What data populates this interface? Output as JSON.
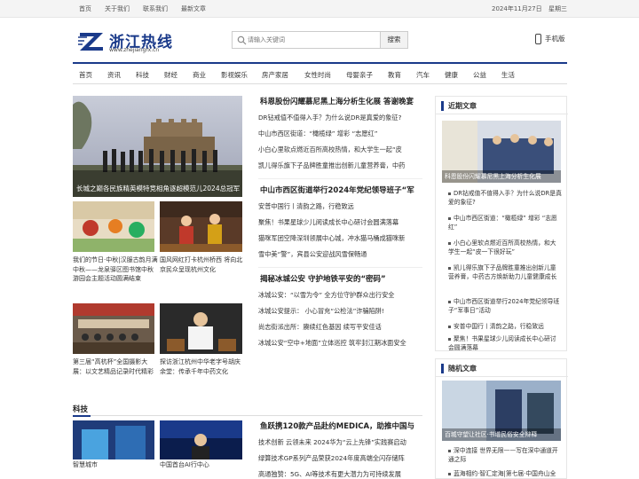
{
  "topbar": {
    "links": [
      "首页",
      "关于我们",
      "联系我们",
      "最新文章"
    ],
    "date": "2024年11月27日",
    "weekday": "星期三"
  },
  "logo": {
    "name": "浙江热线",
    "domain": "www.zhejiangrx.cn"
  },
  "search": {
    "placeholder": "请输入关键词",
    "button": "搜索"
  },
  "mobile": "手机版",
  "nav": [
    "首页",
    "资讯",
    "科技",
    "财经",
    "商业",
    "影视娱乐",
    "房产家居",
    "女性时尚",
    "母婴亲子",
    "教育",
    "汽车",
    "健康",
    "公益",
    "生活"
  ],
  "hero": {
    "caption": "长城之巅各民族精英模特竞相角逐超模范儿2024总冠军"
  },
  "thumbs": [
    {
      "caption": "我们的节日·中秋|汉服古韵月满中秋——龙泉驿区图书馆中秋游园会主题活动圆满结束"
    },
    {
      "caption": "国风网红打卡杭州桥西 将向北京民众呈现杭州文化"
    },
    {
      "caption": "第三届“高杭杯”全国摄影大展：以文艺精品记录时代精彩"
    },
    {
      "caption": "探访浙江杭州中华老字号胡庆余堂：传承千年中药文化"
    }
  ],
  "news": [
    {
      "head": "科恩股份闪耀慕尼黑上海分析生化展 答谢晚宴",
      "items": [
        "DR钻戒值不值得入手？为什么说DR是真爱的象征?",
        "中山市西区街道：“橄榄绿” 增彩 “志愿红”",
        "小白心里软点燃近百所高校热情，和大学生一起“皮",
        "凯儿得乐旗下子品牌胜童推出创新儿童营养膏，中药"
      ]
    },
    {
      "head": "中山市西区街道举行2024年党纪领导班子“军",
      "items": [
        "安普中国行丨清韵之路，行稳致远",
        "聚焦！书果星球少儿阅读成长中心研讨会圆满落幕",
        "猫咪军团空降深圳领展中心城，冲水猫马桶成猫咪新",
        "雪中美“警”，宾县公安迎战风雪保畅通"
      ]
    },
    {
      "head": "揭秘冰城公安 守护地铁平安的“密码”",
      "items": [
        "冰城公安：“以雪为令” 全方位守护群众出行安全",
        "冰城公安提示： 小心冒充“公检法”诈骗陷阱!",
        "尚志街派出所：赓续红色基因 续写平安佳话",
        "冰城公安“空中+地面”立体巡控 筑牢封江期冰面安全"
      ]
    }
  ],
  "sidebar": {
    "recent": {
      "title": "近期文章",
      "image_caption": "科恩股份闪耀慕尼黑上海分析生化展",
      "items": [
        "DR钻戒值不值得入手？为什么说DR是真爱的象征?",
        "中山市西区街道：“橄榄绿” 增彩 “志愿红”",
        "小白心里软点燃近百所高校热情，和大学生一起“皮一下很好玩”",
        "凯儿得乐旗下子品牌胜童推出创新儿童营养膏，中药古方焕新助力儿童健康成长",
        "中山市西区街道举行2024年党纪领导班子“军事日”活动",
        "安普中国行丨清韵之路，行稳致远",
        "聚焦！书果星球少儿阅读成长中心研讨会圆满落幕"
      ]
    },
    "random": {
      "title": "随机文章",
      "image_caption": "百城守望让社区·书增民俗安全辩释",
      "items": [
        "深中连接 世界无限——写在深中通道开通之际",
        "蓝海相约·智汇定海|第七届·中国舟山全"
      ]
    }
  },
  "section2": {
    "title": "科技",
    "headline": "鱼跃携120款产品赴约MEDICA，助推中国与",
    "items": [
      "技术创新 云领未来 2024华为“云上先锋”实践赛启动",
      "绿算技术GP系列产品荣获2024年度高端全闪存储阵",
      "高通独赞：5G、AI等技术有更大潜力为可持续发展"
    ],
    "thumb_caption_1": "智慧城市",
    "thumb_caption_2": "中国首台AI行中心"
  },
  "colors": {
    "brand": "#1a3a8a",
    "topbar_bg": "#f4f4f4"
  }
}
